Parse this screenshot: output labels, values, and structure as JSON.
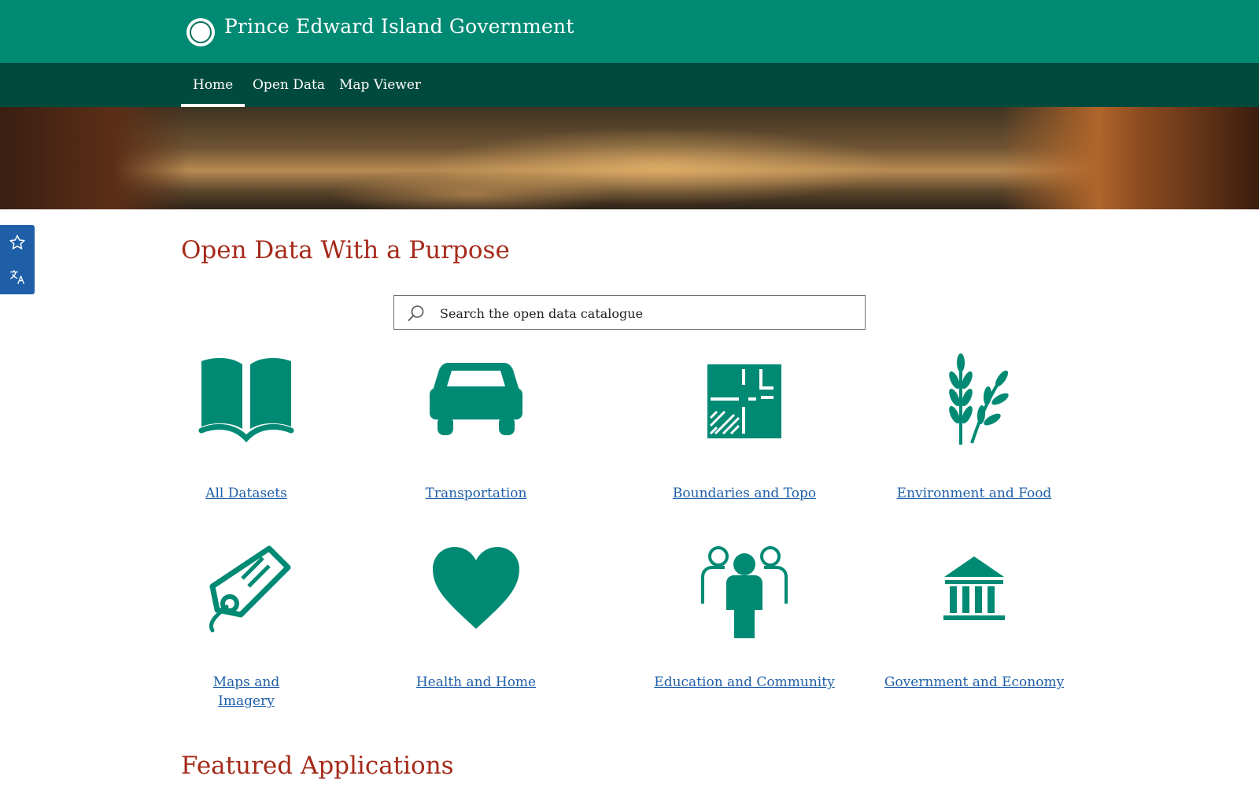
{
  "header": {
    "site_title": "Prince Edward Island Government",
    "seal_icon": "pei-seal-icon",
    "seal_text": "Prince Edward Island"
  },
  "nav": {
    "items": [
      {
        "label": "Home",
        "active": true
      },
      {
        "label": "Open Data",
        "active": false
      },
      {
        "label": "Map Viewer",
        "active": false
      }
    ]
  },
  "side_tools": {
    "favorite_icon": "star-icon",
    "translate_icon": "translate-icon"
  },
  "main": {
    "title": "Open Data With a Purpose",
    "search": {
      "placeholder": "Search the open data catalogue",
      "value": ""
    },
    "categories": [
      {
        "label": "All Datasets",
        "icon": "open-book-icon"
      },
      {
        "label": "Transportation",
        "icon": "car-icon"
      },
      {
        "label": "Boundaries and Topo",
        "icon": "floor-plan-icon"
      },
      {
        "label": "Environment and Food",
        "icon": "wheat-icon"
      },
      {
        "label": "Maps and Imagery",
        "icon": "tag-icon"
      },
      {
        "label": "Health and Home",
        "icon": "heart-icon"
      },
      {
        "label": "Education and Community",
        "icon": "people-icon"
      },
      {
        "label": "Government and Economy",
        "icon": "government-building-icon"
      }
    ],
    "featured_title": "Featured Applications"
  },
  "colors": {
    "header_green": "#008a74",
    "nav_dark_green": "#004a3d",
    "icon_teal": "#008a74",
    "title_red": "#a52a1a",
    "link_blue": "#1f5fa8",
    "side_tools_blue": "#1f5fa8"
  }
}
